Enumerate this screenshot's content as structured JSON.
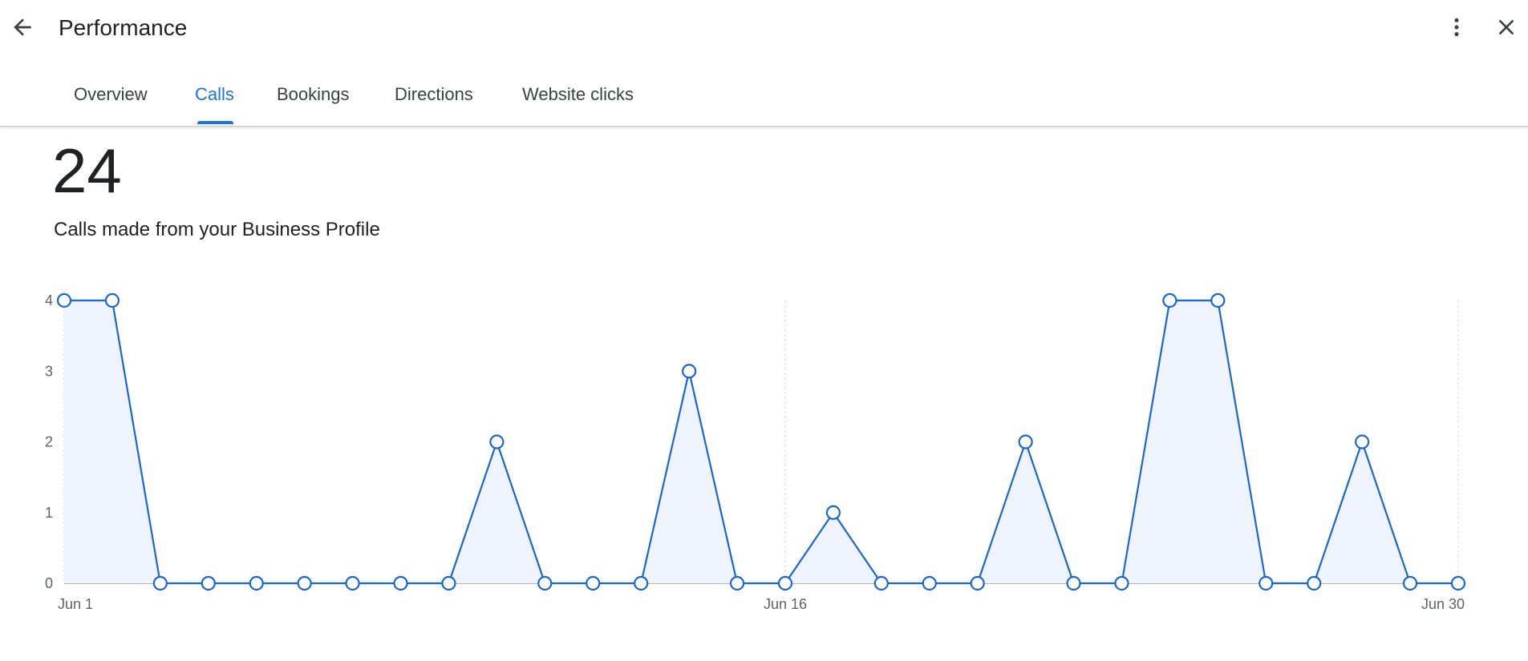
{
  "header": {
    "title": "Performance",
    "icons": {
      "back": "arrow-back-icon",
      "more": "more-vert-icon",
      "close": "close-icon"
    }
  },
  "tabs": [
    {
      "label": "Overview",
      "active": false
    },
    {
      "label": "Calls",
      "active": true
    },
    {
      "label": "Bookings",
      "active": false
    },
    {
      "label": "Directions",
      "active": false
    },
    {
      "label": "Website clicks",
      "active": false
    }
  ],
  "summary": {
    "total": "24",
    "description": "Calls made from your Business Profile"
  },
  "colors": {
    "accent": "#1a73e8",
    "line": "#1967d2",
    "fill": "#eef3fd"
  },
  "chart_data": {
    "type": "area",
    "x": [
      "Jun 1",
      "Jun 2",
      "Jun 3",
      "Jun 4",
      "Jun 5",
      "Jun 6",
      "Jun 7",
      "Jun 8",
      "Jun 9",
      "Jun 10",
      "Jun 11",
      "Jun 12",
      "Jun 13",
      "Jun 14",
      "Jun 15",
      "Jun 16",
      "Jun 17",
      "Jun 18",
      "Jun 19",
      "Jun 20",
      "Jun 21",
      "Jun 22",
      "Jun 23",
      "Jun 24",
      "Jun 25",
      "Jun 26",
      "Jun 27",
      "Jun 28",
      "Jun 29",
      "Jun 30"
    ],
    "series": [
      {
        "values": [
          4,
          4,
          0,
          0,
          0,
          0,
          0,
          0,
          0,
          2,
          0,
          0,
          0,
          3,
          0,
          0,
          1,
          0,
          0,
          0,
          2,
          0,
          0,
          4,
          4,
          0,
          0,
          2,
          0,
          0
        ]
      }
    ],
    "y_ticks": [
      "0",
      "1",
      "2",
      "3",
      "4"
    ],
    "x_tick_labels": [
      "Jun 1",
      "Jun 16",
      "Jun 30"
    ],
    "ylim": [
      0,
      4
    ],
    "title": "",
    "xlabel": "",
    "ylabel": ""
  }
}
